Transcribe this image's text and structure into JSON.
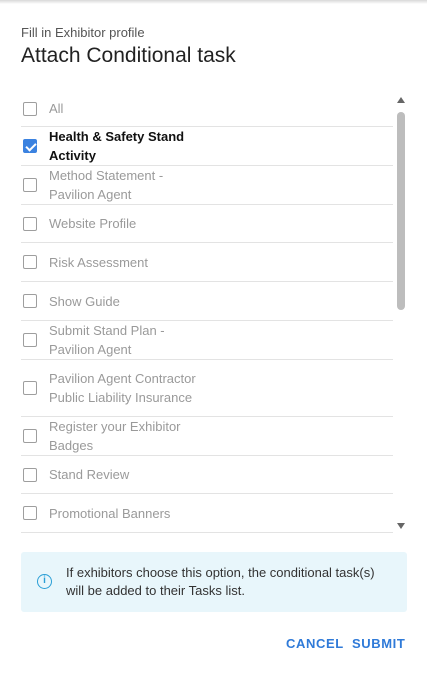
{
  "dialog": {
    "subtitle": "Fill in Exhibitor profile",
    "title": "Attach Conditional task"
  },
  "tasks": [
    {
      "label": "All",
      "checked": false
    },
    {
      "label": "Health & Safety Stand Activity",
      "checked": true
    },
    {
      "label": "Method Statement - Pavilion Agent",
      "checked": false
    },
    {
      "label": "Website Profile",
      "checked": false
    },
    {
      "label": "Risk Assessment",
      "checked": false
    },
    {
      "label": "Show Guide",
      "checked": false
    },
    {
      "label": "Submit Stand Plan - Pavilion Agent",
      "checked": false
    },
    {
      "label": "Pavilion Agent Contractor Public Liability Insurance",
      "checked": false
    },
    {
      "label": "Register your Exhibitor Badges",
      "checked": false
    },
    {
      "label": "Stand Review",
      "checked": false
    },
    {
      "label": "Promotional Banners",
      "checked": false
    }
  ],
  "info": {
    "icon": "info-icon",
    "text": "If exhibitors choose this option, the conditional task(s) will be added to their Tasks list."
  },
  "actions": {
    "cancel_label": "CANCEL",
    "submit_label": "SUBMIT"
  },
  "colors": {
    "accent": "#2f7ad8",
    "checkbox_checked": "#3b82e0",
    "info_background": "#e8f6fb",
    "info_icon": "#2a9fd6"
  }
}
